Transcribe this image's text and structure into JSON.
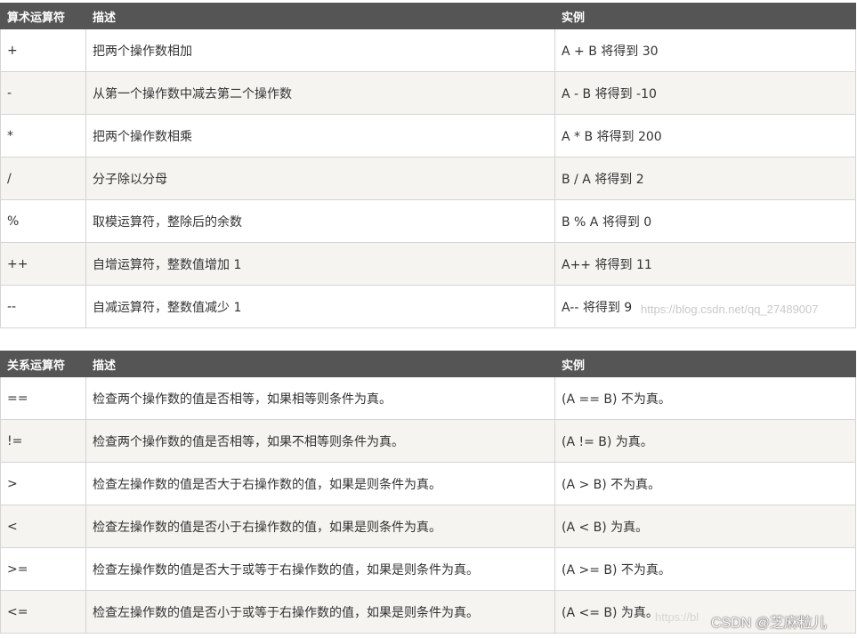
{
  "arithmetic_table": {
    "headers": [
      "算术运算符",
      "描述",
      "实例"
    ],
    "rows": [
      [
        "+",
        "把两个操作数相加",
        "A + B 将得到 30"
      ],
      [
        "-",
        "从第一个操作数中减去第二个操作数",
        "A - B 将得到 -10"
      ],
      [
        "*",
        "把两个操作数相乘",
        "A * B 将得到 200"
      ],
      [
        "/",
        "分子除以分母",
        "B / A 将得到 2"
      ],
      [
        "%",
        "取模运算符，整除后的余数",
        "B % A 将得到 0"
      ],
      [
        "++",
        "自增运算符，整数值增加 1",
        "A++ 将得到 11"
      ],
      [
        "--",
        "自减运算符，整数值减少 1",
        "A-- 将得到 9"
      ]
    ]
  },
  "relational_table": {
    "headers": [
      "关系运算符",
      "描述",
      "实例"
    ],
    "rows": [
      [
        "==",
        "检查两个操作数的值是否相等，如果相等则条件为真。",
        "(A == B) 不为真。"
      ],
      [
        "!=",
        "检查两个操作数的值是否相等，如果不相等则条件为真。",
        "(A != B) 为真。"
      ],
      [
        ">",
        "检查左操作数的值是否大于右操作数的值，如果是则条件为真。",
        "(A > B) 不为真。"
      ],
      [
        "<",
        "检查左操作数的值是否小于右操作数的值，如果是则条件为真。",
        "(A < B) 为真。"
      ],
      [
        ">=",
        "检查左操作数的值是否大于或等于右操作数的值，如果是则条件为真。",
        "(A >= B) 不为真。"
      ],
      [
        "<=",
        "检查左操作数的值是否小于或等于右操作数的值，如果是则条件为真。",
        "(A <= B) 为真。"
      ]
    ]
  },
  "watermarks": {
    "url": "https://blog.csdn.net/qq_27489007",
    "url_partial": "https://bl",
    "credit": "CSDN @芝麻粒儿"
  }
}
